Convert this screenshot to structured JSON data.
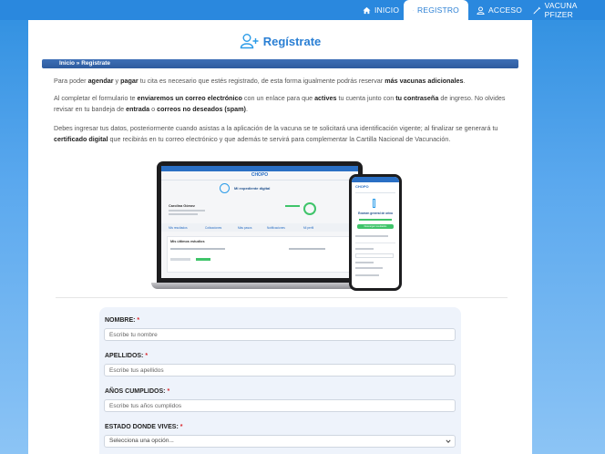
{
  "nav": {
    "items": [
      {
        "label": "INICIO",
        "icon": "home-icon"
      },
      {
        "label": "REGISTRO",
        "icon": "id-card-icon",
        "active": true
      },
      {
        "label": "ACCESO",
        "icon": "user-icon"
      },
      {
        "label": "VACUNA PFIZER",
        "icon": "syringe-icon"
      }
    ]
  },
  "page": {
    "title": "Regístrate",
    "breadcrumb": {
      "home": "Inicio",
      "sep": "»",
      "current": "Registrate"
    }
  },
  "paragraphs": {
    "p1": {
      "a": "Para poder ",
      "b1": "agendar",
      "c": " y ",
      "b2": "pagar",
      "d": " tu cita es necesario que estés registrado, de esta forma igualmente podrás reservar ",
      "b3": "más vacunas adicionales",
      "e": "."
    },
    "p2": {
      "a": "Al completar el formulario te ",
      "b1": "enviaremos un correo electrónico",
      "c": " con un enlace para que ",
      "b2": "actives",
      "d": " tu cuenta junto con ",
      "b3": "tu contraseña",
      "e": " de ingreso. No olvides revisar en tu bandeja de ",
      "b4": "entrada",
      "f": " o ",
      "b5": "correos no deseados (spam)",
      "g": "."
    },
    "p3": {
      "a": "Debes ingresar tus datos, posteriormente cuando asistas a la aplicación de la vacuna se te solicitará una identificación vigente; al finalizar se generará tu ",
      "b1": "certificado digital",
      "c": " que recibirás en tu correo electrónico y que además te servirá para complementar la Cartilla Nacional de Vacunación."
    }
  },
  "illustration": {
    "brand": "CHOPO",
    "laptop_heading": "Mi expediente digital",
    "patient_name": "Carolina Gómez",
    "tabs": [
      "Mis resultados",
      "Cotizaciones",
      "Más pasos",
      "Notificaciones",
      "Mi perfil"
    ],
    "recent_title": "Mis últimos estudios",
    "phone_heading": "Examen general de orina",
    "phone_button": "Descargar resultados"
  },
  "form": {
    "fields": [
      {
        "label": "NOMBRE:",
        "required": "*",
        "placeholder": "Escribe tu nombre"
      },
      {
        "label": "APELLIDOS:",
        "required": "*",
        "placeholder": "Escribe tus apellidos"
      },
      {
        "label": "AÑOS CUMPLIDOS:",
        "required": "*",
        "placeholder": "Escribe tus años cumplidos"
      },
      {
        "label": "ESTADO DONDE VIVES:",
        "required": "*",
        "placeholder": "Selecciona una opción..."
      }
    ]
  },
  "colors": {
    "accent": "#2a7fd4",
    "breadcrumb_bar": "#2e5b9e",
    "required": "#d9262b",
    "form_bg": "#eef3fb"
  }
}
